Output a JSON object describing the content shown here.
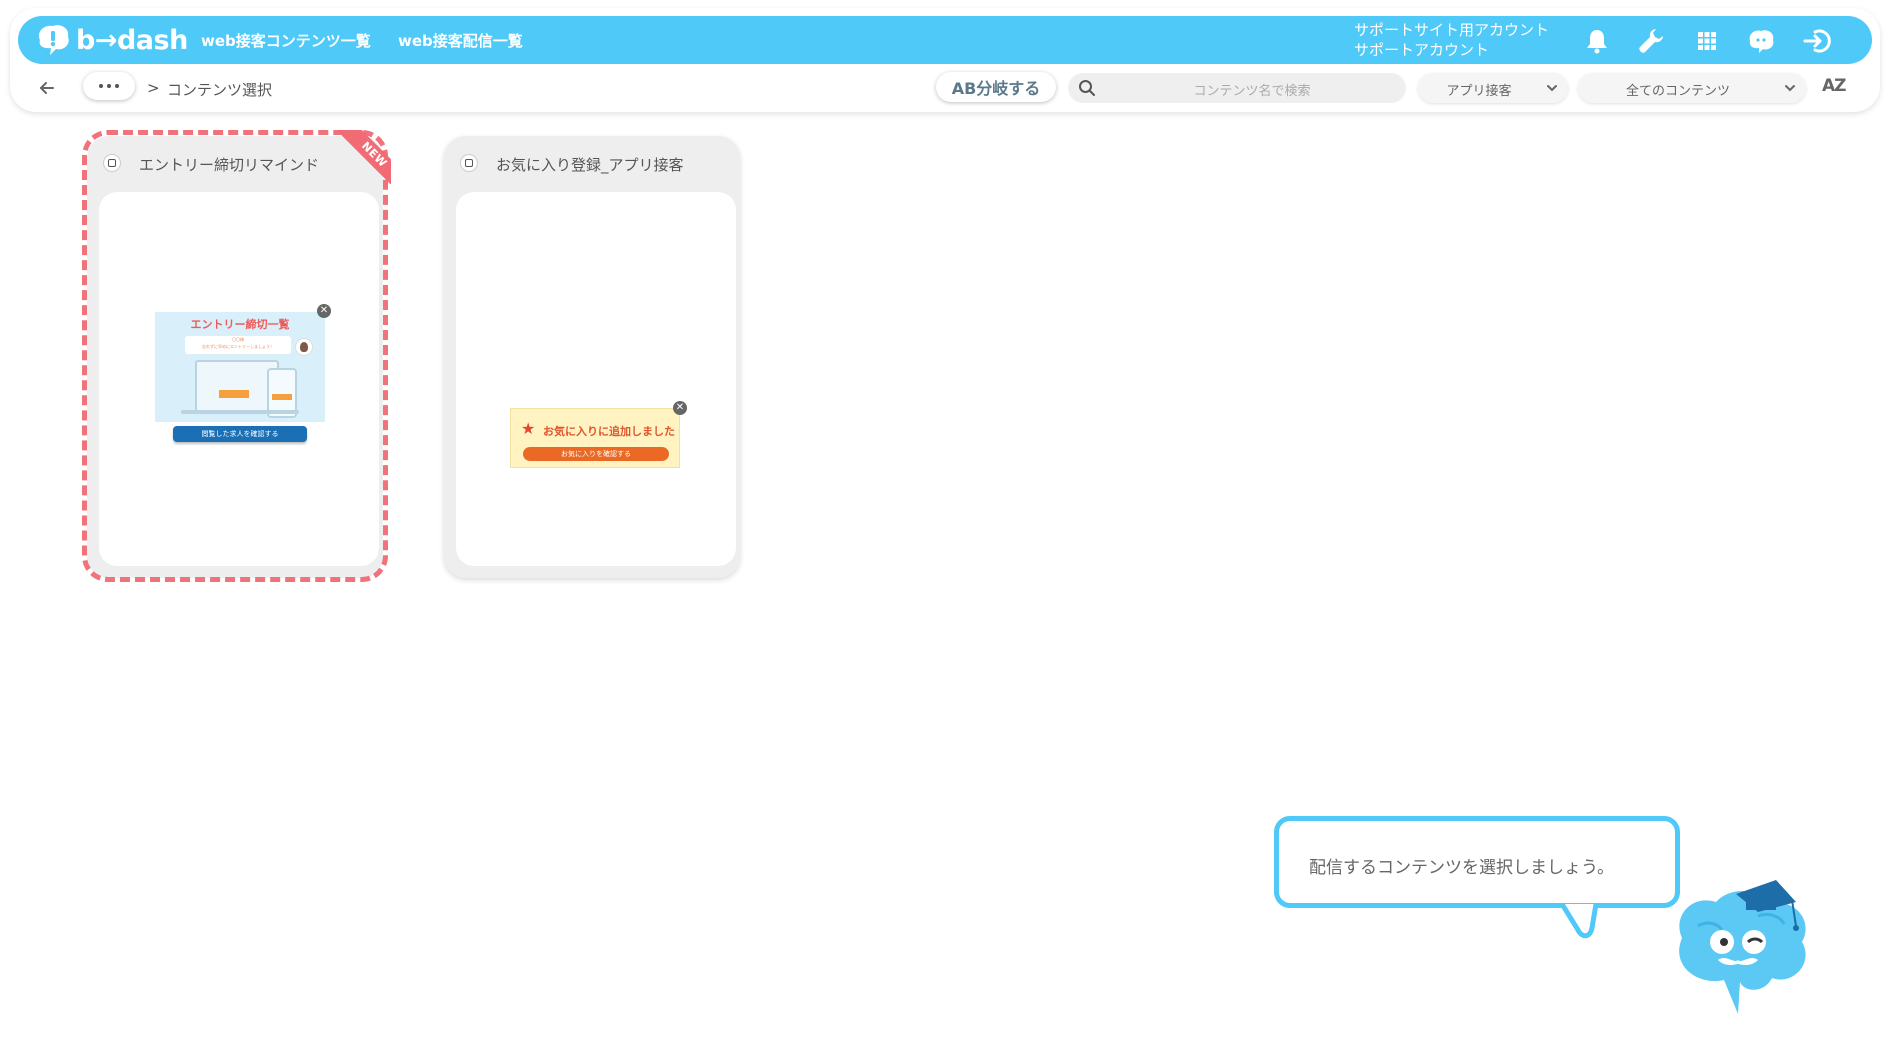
{
  "header": {
    "logo_text": "b→dash",
    "nav": [
      {
        "label": "web接客コンテンツ一覧"
      },
      {
        "label": "web接客配信一覧"
      }
    ],
    "account_line1": "サポートサイト用アカウント",
    "account_line2": "サポートアカウント",
    "icons": [
      "bell-icon",
      "wrench-icon",
      "apps-grid-icon",
      "chat-mascot-icon",
      "logout-icon"
    ]
  },
  "toolbar": {
    "breadcrumb_sep": ">",
    "breadcrumb_current": "コンテンツ選択",
    "ab_button": "AB分岐する",
    "search_placeholder": "コンテンツ名で検索",
    "type_select": "アプリ接客",
    "content_select": "全てのコンテンツ",
    "sort_label": "AZ"
  },
  "cards": [
    {
      "title": "エントリー締切リマインド",
      "badge": "NEW",
      "selected": true,
      "preview": {
        "heading": "エントリー締切一覧",
        "bubble_line1": "〇〇様",
        "bubble_line2": "忘れずに早めにエントリーしましょう！",
        "cta": "閲覧した求人を確認する"
      }
    },
    {
      "title": "お気に入り登録_アプリ接客",
      "badge": "",
      "selected": false,
      "preview": {
        "heading": "お気に入りに追加しました",
        "cta": "お気に入りを確認する"
      }
    }
  ],
  "assistant": {
    "message": "配信するコンテンツを選択しましょう。"
  },
  "colors": {
    "brand": "#4fc9f7",
    "selection_dashed": "#f0737b",
    "badge": "#f26b74"
  }
}
